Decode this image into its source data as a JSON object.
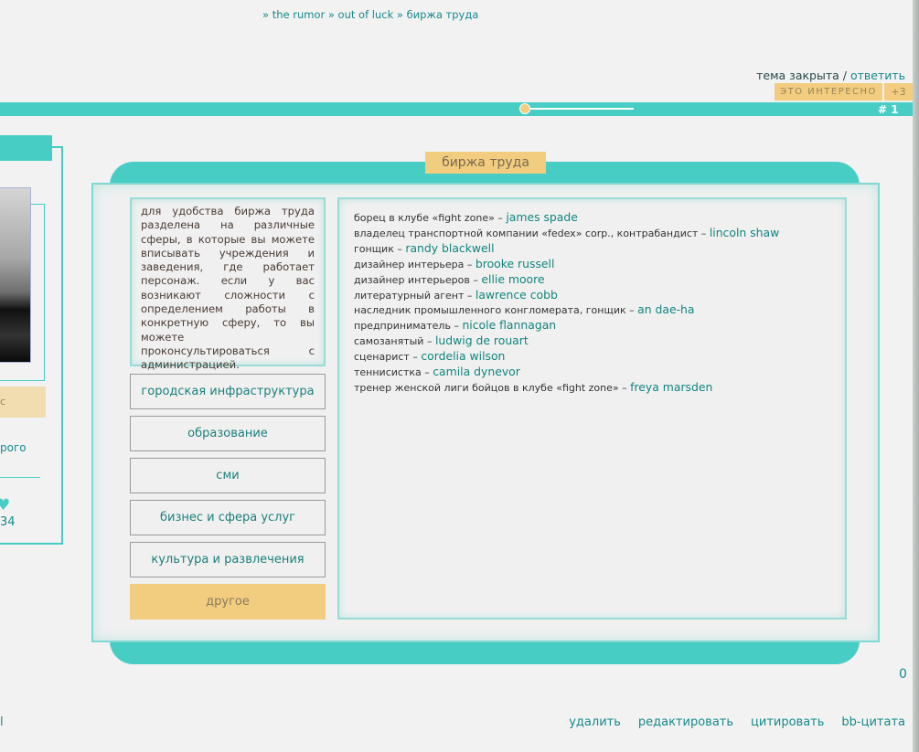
{
  "breadcrumb": {
    "items": [
      "» the rumor",
      "» out of luck",
      "» биржа труда"
    ]
  },
  "topic": {
    "status": "тема закрыта",
    "separator": " / ",
    "reply": "ответить"
  },
  "like": {
    "label": "ЭТО ИНТЕРЕСНО",
    "count": "+3"
  },
  "post": {
    "number": "# 1",
    "rating": "0"
  },
  "profile": {
    "badge_text": "с",
    "text": "рого",
    "heart_icon": "heart-icon",
    "count": "34",
    "left_edge_text": "l"
  },
  "main": {
    "title": "биржа труда",
    "description": "для удобства биржа труда разделена на различные сферы, в которые вы можете вписывать учреждения и заведения, где работает персонаж. если у вас возникают сложности с определением работы в конкретную сферу, то вы можете проконсультироваться с администрацией.",
    "categories": [
      {
        "label": "городская инфраструктура"
      },
      {
        "label": "образование"
      },
      {
        "label": "сми"
      },
      {
        "label": "бизнес и сфера услуг"
      },
      {
        "label": "культура и развлечения"
      },
      {
        "label": "другое",
        "active": true
      }
    ],
    "entries": [
      {
        "job": "борец в клубе «fight zone» – ",
        "name": "james spade"
      },
      {
        "job": "владелец транспортной компании «fedex» corp., контрабандист – ",
        "name": "lincoln shaw"
      },
      {
        "job": "гонщик – ",
        "name": "randy blackwell"
      },
      {
        "job": "дизайнер интерьера – ",
        "name": "brooke russell"
      },
      {
        "job": "дизайнер интерьеров – ",
        "name": "ellie moore"
      },
      {
        "job": "литературный агент – ",
        "name": "lawrence cobb"
      },
      {
        "job": "наследник промышленного конгломерата, гонщик – ",
        "name": "an dae-ha"
      },
      {
        "job": "предприниматель – ",
        "name": "nicole flannagan"
      },
      {
        "job": "самозанятый – ",
        "name": "ludwig de rouart"
      },
      {
        "job": "сценарист – ",
        "name": "cordelia wilson"
      },
      {
        "job": "теннисистка – ",
        "name": "camila dynevor"
      },
      {
        "job": "тренер женской лиги бойцов в клубе «fight zone» – ",
        "name": "freya marsden"
      }
    ]
  },
  "actions": [
    "удалить",
    "редактировать",
    "цитировать",
    "bb-цитата"
  ],
  "colors": {
    "accent": "#48cdc5",
    "highlight": "#f2cd80",
    "link": "#17898a"
  }
}
